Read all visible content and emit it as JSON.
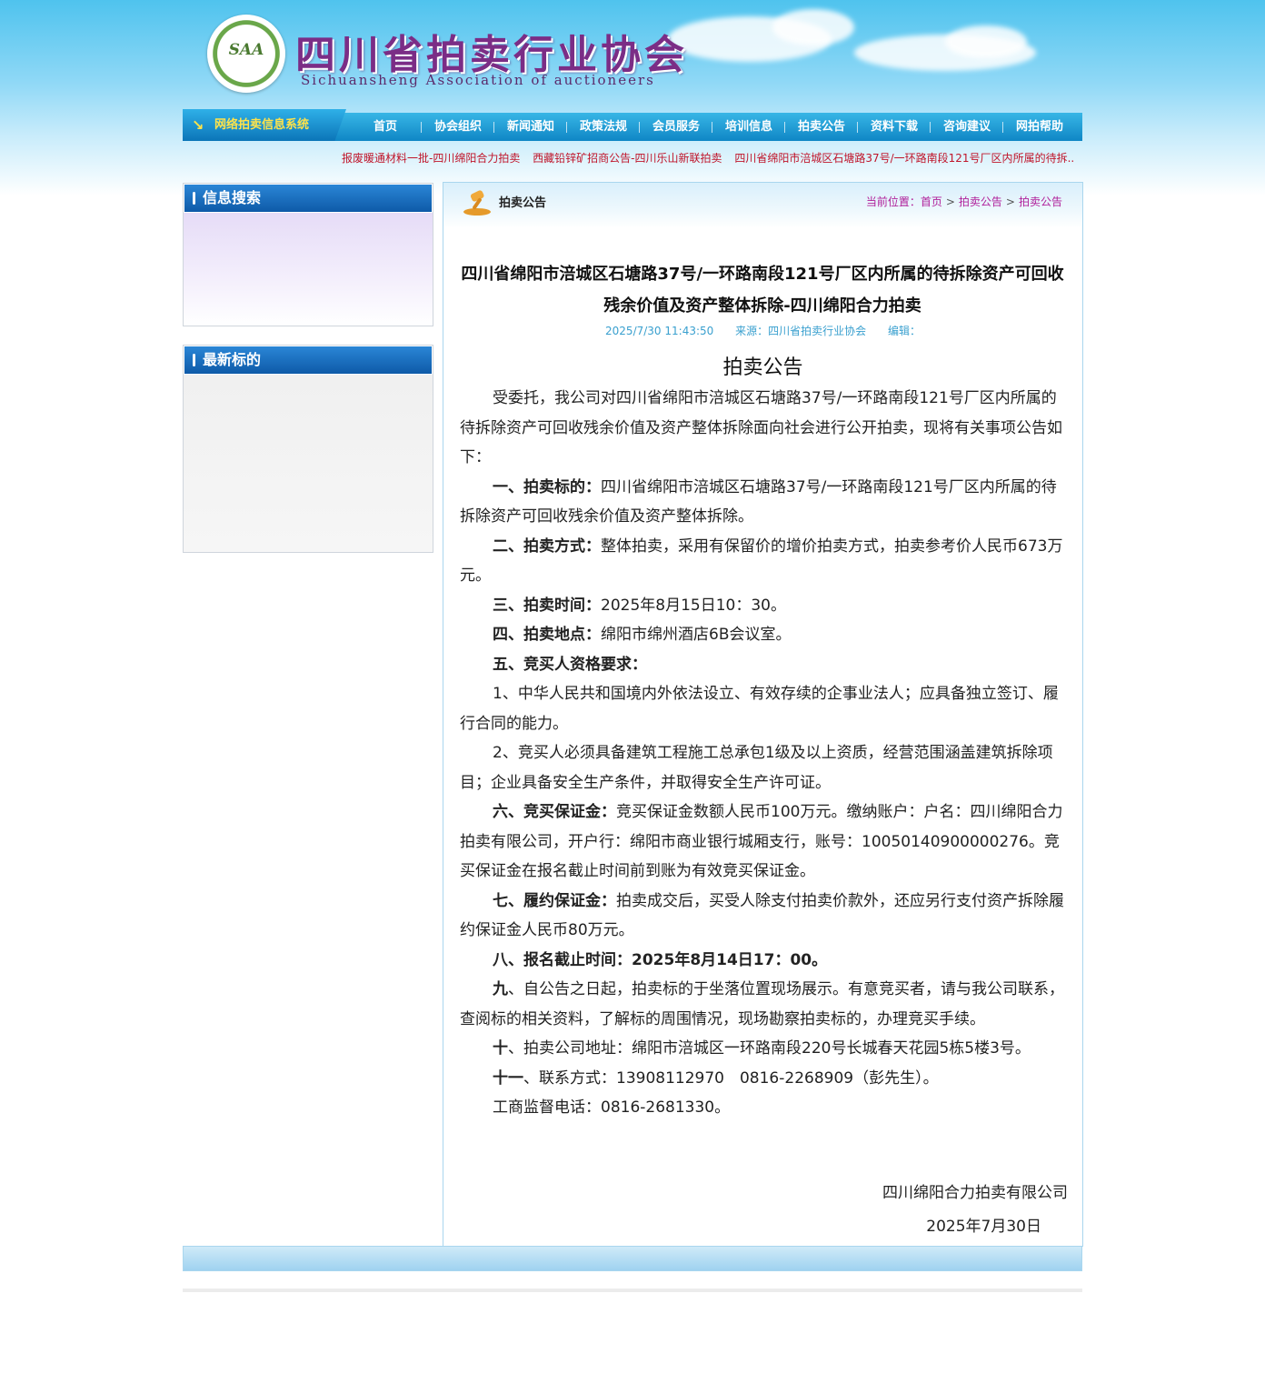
{
  "header": {
    "seal_text": "SAA",
    "title_cn": "四川省拍卖行业协会",
    "title_en": "Sichuansheng Association of auctioneers"
  },
  "nav": {
    "system_tab": "网络拍卖信息系统",
    "items": [
      "首页",
      "协会组织",
      "新闻通知",
      "政策法规",
      "会员服务",
      "培训信息",
      "拍卖公告",
      "资料下载",
      "咨询建议",
      "网拍帮助"
    ]
  },
  "ticker": [
    "报废暖通材料一批-四川绵阳合力拍卖",
    "西藏铅锌矿招商公告-四川乐山新联拍卖",
    "四川省绵阳市涪城区石塘路37号/一环路南段121号厂区内所属的待拆.."
  ],
  "sidebar": {
    "search_title": "信息搜索",
    "latest_title": "最新标的"
  },
  "main": {
    "section_title": "拍卖公告",
    "breadcrumb": {
      "label": "当前位置：",
      "items": [
        "首页",
        "拍卖公告",
        "拍卖公告"
      ],
      "separator": ">"
    },
    "article_title": "四川省绵阳市涪城区石塘路37号/一环路南段121号厂区内所属的待拆除资产可回收残余价值及资产整体拆除-四川绵阳合力拍卖",
    "meta": {
      "date": "2025/7/30 11:43:50",
      "source": "来源：四川省拍卖行业协会",
      "editor": "编辑："
    },
    "announcement_heading": "拍卖公告",
    "paragraphs": [
      {
        "bold": "",
        "text": "受委托，我公司对四川省绵阳市涪城区石塘路37号/一环路南段121号厂区内所属的待拆除资产可回收残余价值及资产整体拆除面向社会进行公开拍卖，现将有关事项公告如下："
      },
      {
        "bold": "一、拍卖标的：",
        "text": "四川省绵阳市涪城区石塘路37号/一环路南段121号厂区内所属的待拆除资产可回收残余价值及资产整体拆除。"
      },
      {
        "bold": "二、拍卖方式：",
        "text": "整体拍卖，采用有保留价的增价拍卖方式，拍卖参考价人民币673万元。"
      },
      {
        "bold": "三、拍卖时间：",
        "text": "2025年8月15日10：30。"
      },
      {
        "bold": "四、拍卖地点：",
        "text": "绵阳市绵州酒店6B会议室。"
      },
      {
        "bold": "五、竞买人资格要求：",
        "text": ""
      },
      {
        "bold": "",
        "text": "1、中华人民共和国境内外依法设立、有效存续的企事业法人；应具备独立签订、履行合同的能力。"
      },
      {
        "bold": "",
        "text": "2、竞买人必须具备建筑工程施工总承包1级及以上资质，经营范围涵盖建筑拆除项目；企业具备安全生产条件，并取得安全生产许可证。"
      },
      {
        "bold": "六、竞买保证金：",
        "text": "竞买保证金数额人民币100万元。缴纳账户：户名：四川绵阳合力拍卖有限公司，开户行：绵阳市商业银行城厢支行，账号：10050140900000276。竞买保证金在报名截止时间前到账为有效竞买保证金。"
      },
      {
        "bold": "七、履约保证金：",
        "text": "拍卖成交后，买受人除支付拍卖价款外，还应另行支付资产拆除履约保证金人民币80万元。"
      },
      {
        "bold": "八、报名截止时间：",
        "text": "2025年8月14日17：00。",
        "all_bold": true
      },
      {
        "bold": "九",
        "text": "、自公告之日起，拍卖标的于坐落位置现场展示。有意竞买者，请与我公司联系，查阅标的相关资料，了解标的周围情况，现场勘察拍卖标的，办理竞买手续。"
      },
      {
        "bold": "十",
        "text": "、拍卖公司地址：绵阳市涪城区一环路南段220号长城春天花园5栋5楼3号。"
      },
      {
        "bold": "十一",
        "text": "、联系方式：13908112970　0816-2268909（彭先生）。"
      },
      {
        "bold": "",
        "text": "工商监督电话：0816-2681330。"
      }
    ],
    "signature": "四川绵阳合力拍卖有限公司",
    "signature_date": "2025年7月30日"
  }
}
